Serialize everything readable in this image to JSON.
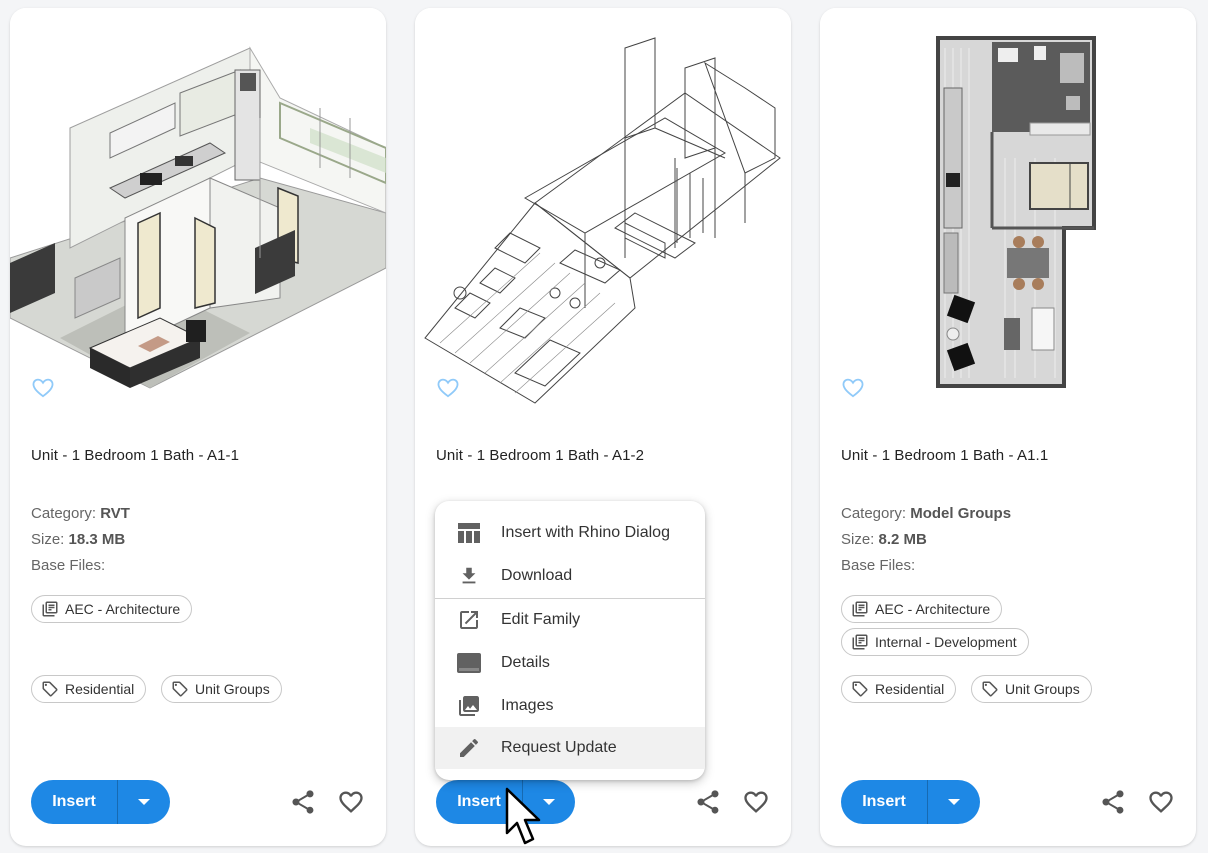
{
  "cards": [
    {
      "title": "Unit - 1 Bedroom 1 Bath - A1-1",
      "category_label": "Category:",
      "category": "RVT",
      "size_label": "Size:",
      "size": "18.3 MB",
      "base_files_label": "Base Files:",
      "libraries": [
        "AEC - Architecture"
      ],
      "tags": [
        "Residential",
        "Unit Groups"
      ],
      "insert_label": "Insert"
    },
    {
      "title": "Unit - 1 Bedroom 1 Bath - A1-2",
      "insert_label": "Insert"
    },
    {
      "title": "Unit - 1 Bedroom 1 Bath - A1.1",
      "category_label": "Category:",
      "category": "Model Groups",
      "size_label": "Size:",
      "size": "8.2 MB",
      "base_files_label": "Base Files:",
      "libraries": [
        "AEC - Architecture",
        "Internal - Development"
      ],
      "tags": [
        "Residential",
        "Unit Groups"
      ],
      "insert_label": "Insert"
    }
  ],
  "insert_menu": {
    "items": [
      {
        "label": "Insert with Rhino Dialog",
        "icon": "table-layout-icon"
      },
      {
        "label": "Download",
        "icon": "download-icon"
      },
      {
        "label": "Edit Family",
        "icon": "open-external-icon"
      },
      {
        "label": "Details",
        "icon": "details-panel-icon"
      },
      {
        "label": "Images",
        "icon": "image-library-icon"
      },
      {
        "label": "Request Update",
        "icon": "pencil-icon"
      }
    ],
    "highlighted_item": "Request Update"
  },
  "colors": {
    "accent": "#1e88e5",
    "favorite_outline": "#90caf9",
    "icon_gray": "#555555",
    "menu_icon": "#616161"
  }
}
